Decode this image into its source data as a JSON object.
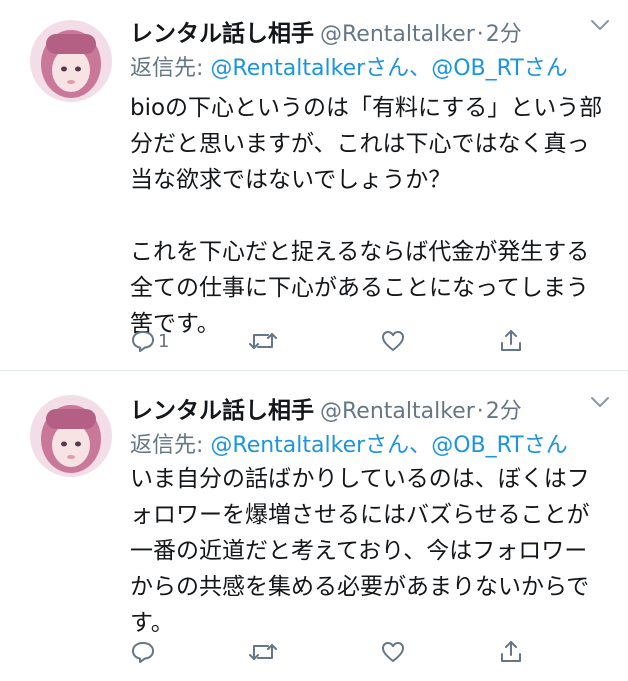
{
  "tweets": [
    {
      "name": "レンタル話し相手",
      "handle": "@Rentaltalker",
      "dot": "·",
      "time": "2分",
      "reply_prefix": "返信先: ",
      "reply_mentions": [
        "@Rentaltalkerさん",
        "@OB_RTさん"
      ],
      "reply_sep": "、",
      "paragraphs": [
        "bioの下心というのは「有料にする」という部分だと思いますが、これは下心ではなく真っ当な欲求ではないでしょうか？",
        "これを下心だと捉えるならば代金が発生する全ての仕事に下心があることになってしまう筈です。"
      ],
      "reply_count": "1"
    },
    {
      "name": "レンタル話し相手",
      "handle": "@Rentaltalker",
      "dot": "·",
      "time": "2分",
      "reply_prefix": "返信先: ",
      "reply_mentions": [
        "@Rentaltalkerさん",
        "@OB_RTさん"
      ],
      "reply_sep": "、",
      "paragraphs": [
        "いま自分の話ばかりしているのは、ぼくはフォロワーを爆増させるにはバズらせることが一番の近道だと考えており、今はフォロワーからの共感を集める必要があまりないからです。"
      ],
      "reply_count": ""
    }
  ],
  "icons": {
    "reply": "reply-icon",
    "retweet": "retweet-icon",
    "like": "heart-icon",
    "share": "share-icon",
    "menu": "chevron-down-icon"
  },
  "colors": {
    "text": "#14171a",
    "secondary": "#657786",
    "link": "#1b95e0",
    "divider": "#e1e8ed"
  }
}
